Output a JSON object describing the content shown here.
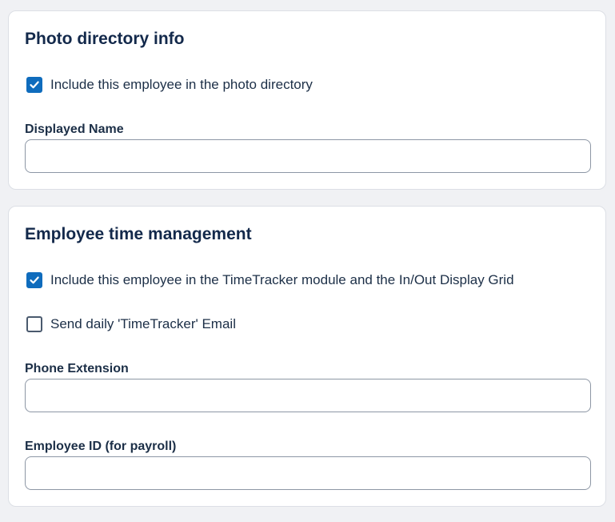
{
  "photo_directory": {
    "title": "Photo directory info",
    "include_checkbox": {
      "label": "Include this employee in the photo directory",
      "checked": true
    },
    "displayed_name": {
      "label": "Displayed Name",
      "value": "",
      "placeholder": ""
    }
  },
  "time_management": {
    "title": "Employee time management",
    "include_timetracker": {
      "label": "Include this employee in the TimeTracker module and the In/Out Display Grid",
      "checked": true
    },
    "daily_email": {
      "label": "Send daily 'TimeTracker' Email",
      "checked": false
    },
    "phone_extension": {
      "label": "Phone Extension",
      "value": "",
      "placeholder": ""
    },
    "employee_id": {
      "label": "Employee ID (for payroll)",
      "value": "",
      "placeholder": ""
    }
  },
  "colors": {
    "accent": "#0f6cbd",
    "title_text": "#13294b",
    "body_text": "#1c2f47",
    "page_background": "#f0f1f4",
    "card_background": "#ffffff"
  }
}
